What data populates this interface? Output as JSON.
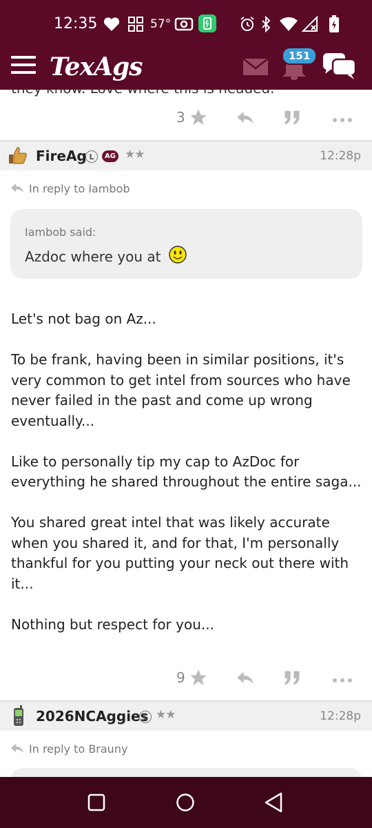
{
  "status": {
    "time": "12:35",
    "temperature": "57°"
  },
  "app": {
    "logo": "TexAgs",
    "notification_count": "151"
  },
  "top_post": {
    "cut_text": "they know. Love where this is headed.",
    "like_count": "3"
  },
  "post1": {
    "username": "FireAg",
    "level_badge": "L",
    "ag_badge": "AG",
    "stars": "★★",
    "time": "12:28p",
    "reply_to": "In reply to Iambob",
    "quote_author": "Iambob said:",
    "quote_text": "Azdoc where you at",
    "paragraphs": [
      "Let's not bag on Az...",
      "To be frank, having been in similar positions, it's very common to get intel from sources who have never failed in the past and come up wrong eventually...",
      "Like to personally tip my cap to AzDoc for everything he shared throughout the entire saga...",
      "You shared great intel that was likely accurate when you shared it, and for that, I'm personally thankful for you putting your neck out there with it...",
      "Nothing but respect for you..."
    ],
    "like_count": "9"
  },
  "post2": {
    "username": "2026NCAggies",
    "level_badge": "L",
    "stars": "★★",
    "time": "12:28p",
    "reply_to": "In reply to Brauny"
  },
  "colors": {
    "brand": "#5a0a26",
    "nav": "#3e0718",
    "badge": "#3a9fd6"
  }
}
